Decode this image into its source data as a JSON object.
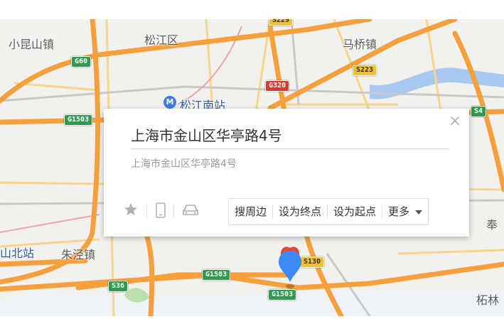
{
  "map": {
    "places": [
      {
        "id": "xiaokunshan",
        "label": "小昆山镇"
      },
      {
        "id": "songjiang",
        "label": "松江区"
      },
      {
        "id": "maqiao",
        "label": "马桥镇"
      },
      {
        "id": "songjiangnan",
        "label": "松江南站"
      },
      {
        "id": "shanbeizhan",
        "label": "山北站"
      },
      {
        "id": "zhujing",
        "label": "朱泾镇"
      },
      {
        "id": "feng",
        "label": "奉"
      },
      {
        "id": "zhelin",
        "label": "柘林"
      }
    ],
    "shields": [
      {
        "id": "g60",
        "label": "G60"
      },
      {
        "id": "g1503a",
        "label": "G1503"
      },
      {
        "id": "g1503b",
        "label": "G1503"
      },
      {
        "id": "g1503c",
        "label": "G1503"
      },
      {
        "id": "g320",
        "label": "G320"
      },
      {
        "id": "s223",
        "label": "S223"
      },
      {
        "id": "s4",
        "label": "S4"
      },
      {
        "id": "s130",
        "label": "S130"
      },
      {
        "id": "s36",
        "label": "S36"
      },
      {
        "id": "s229",
        "label": "S229"
      }
    ],
    "metro_icon": "metro-icon",
    "marker_icon": "location-pin-icon"
  },
  "popup": {
    "title": "上海市金山区华亭路4号",
    "address": "上海市金山区华亭路4号",
    "close_icon": "close-icon",
    "icons": [
      "star-icon",
      "phone-icon",
      "car-icon"
    ],
    "actions": {
      "search_nearby": "搜周边",
      "set_destination": "设为终点",
      "set_origin": "设为起点",
      "more": "更多"
    }
  },
  "colors": {
    "highway": "#f5a03c",
    "road": "#f7d58a",
    "water": "#a9c8f0",
    "popup_bg": "#ffffff",
    "marker_blue": "#3d8af7",
    "marker_red": "#e8453c"
  }
}
